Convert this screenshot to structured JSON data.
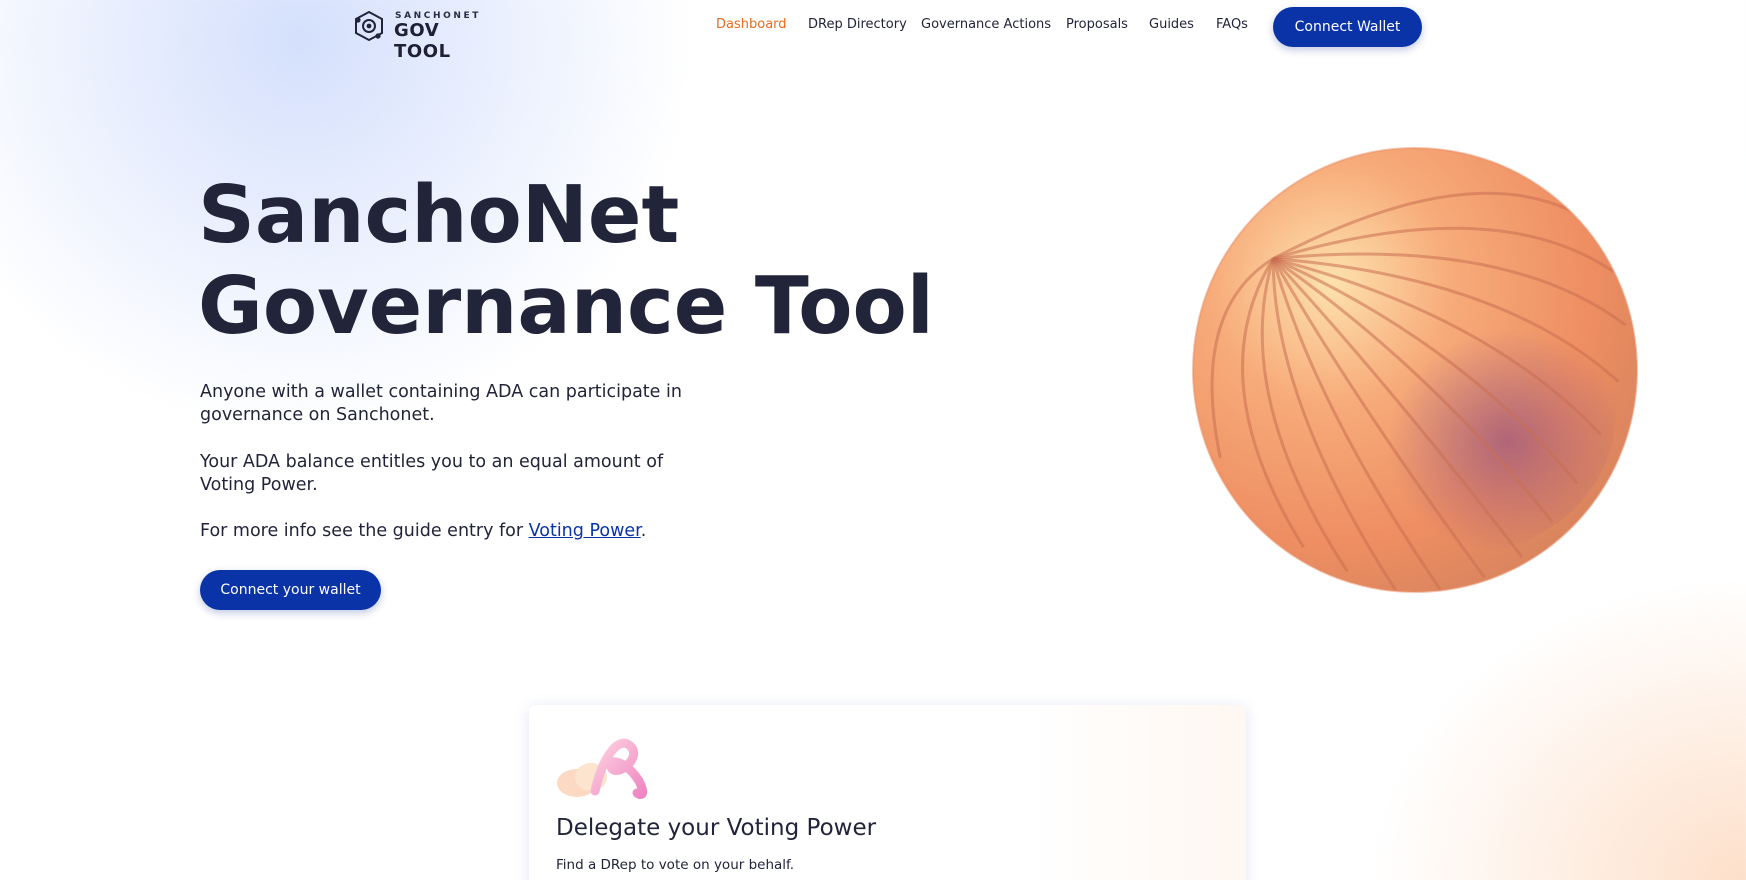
{
  "header": {
    "logo_small": "SANCHONET",
    "logo_big": "GOV TOOL",
    "nav": [
      {
        "label": "Dashboard",
        "active": true
      },
      {
        "label": "DRep Directory",
        "active": false
      },
      {
        "label": "Governance Actions",
        "active": false
      },
      {
        "label": "Proposals",
        "active": false
      },
      {
        "label": "Guides",
        "active": false
      },
      {
        "label": "FAQs",
        "active": false
      }
    ],
    "connect_button": "Connect Wallet"
  },
  "hero": {
    "title_line1": "SanchoNet",
    "title_line2": "Governance Tool",
    "paragraph1": "Anyone with a wallet containing ADA can participate in governance on Sanchonet.",
    "paragraph2": "Your ADA balance entitles you to an equal amount of Voting Power.",
    "paragraph3_prefix": "For more info see the guide entry for ",
    "paragraph3_link": "Voting Power",
    "paragraph3_suffix": ".",
    "connect_button": "Connect your wallet"
  },
  "card": {
    "title": "Delegate your Voting Power",
    "description": "Find a DRep to vote on your behalf."
  },
  "colors": {
    "primary": "#0a33a8",
    "active_nav": "#ea6a1e",
    "text": "#22243a",
    "sphere": "#f3976a"
  }
}
